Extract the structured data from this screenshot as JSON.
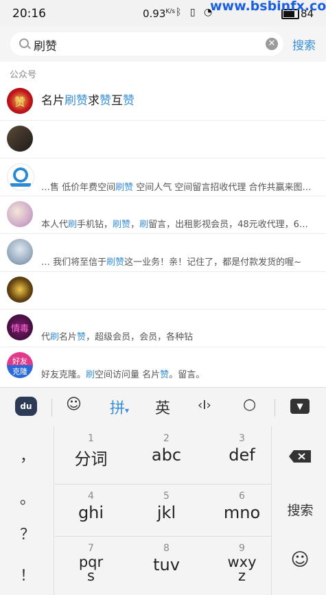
{
  "status": {
    "time": "20:16",
    "speed": "0.93",
    "speed_unit": "K/s",
    "signal": "ᯤ",
    "battery": "84"
  },
  "watermark": "www.bsbinfx.com",
  "search": {
    "query": "刷赞",
    "button": "搜索"
  },
  "section_label": "公众号",
  "results": [
    {
      "segments": [
        {
          "t": "名片",
          "h": false
        },
        {
          "t": "刷赞",
          "h": true
        },
        {
          "t": "求",
          "h": false
        },
        {
          "t": "赞",
          "h": true
        },
        {
          "t": "互",
          "h": false
        },
        {
          "t": "赞",
          "h": true
        }
      ]
    },
    {
      "segments": []
    },
    {
      "segments": [
        {
          "t": "…售 低价年费空间",
          "h": false
        },
        {
          "t": "刷赞",
          "h": true
        },
        {
          "t": " 空间人气 空间留言招收代理 合作共赢来图…",
          "h": false
        }
      ]
    },
    {
      "segments": [
        {
          "t": " 本人代",
          "h": false
        },
        {
          "t": "刷",
          "h": true
        },
        {
          "t": "手机钻，",
          "h": false
        },
        {
          "t": "刷赞",
          "h": true
        },
        {
          "t": "，",
          "h": false
        },
        {
          "t": "刷",
          "h": true
        },
        {
          "t": "留言，出租影视会员，48元收代理，6…",
          "h": false
        }
      ]
    },
    {
      "segments": [
        {
          "t": "… 我们将至信于",
          "h": false
        },
        {
          "t": "刷赞",
          "h": true
        },
        {
          "t": "这一业务！亲！记住了，都是付款发货的喔~",
          "h": false
        }
      ]
    },
    {
      "segments": []
    },
    {
      "segments": [
        {
          "t": "代",
          "h": false
        },
        {
          "t": "刷",
          "h": true
        },
        {
          "t": "名片",
          "h": false
        },
        {
          "t": "赞",
          "h": true
        },
        {
          "t": "，超级会员，会员，各种钻",
          "h": false
        }
      ]
    },
    {
      "segments": [
        {
          "t": "好友克隆。",
          "h": false
        },
        {
          "t": "刷",
          "h": true
        },
        {
          "t": "空间访问量 名片",
          "h": false
        },
        {
          "t": "赞",
          "h": true
        },
        {
          "t": "。留言。",
          "h": false
        }
      ]
    }
  ],
  "keyboard": {
    "toolbar": {
      "pinyin": "拼",
      "english": "英"
    },
    "keys": [
      {
        "num": "1",
        "label": "分词"
      },
      {
        "num": "2",
        "label": "abc"
      },
      {
        "num": "3",
        "label": "def"
      },
      {
        "num": "4",
        "label": "ghi"
      },
      {
        "num": "5",
        "label": "jkl"
      },
      {
        "num": "6",
        "label": "mno"
      },
      {
        "num": "7",
        "label": "pqr\ns"
      },
      {
        "num": "8",
        "label": "tuv"
      },
      {
        "num": "9",
        "label": "wxy\nz"
      }
    ],
    "punct": [
      "，",
      "。",
      "？",
      "！"
    ],
    "search_key": "搜索"
  },
  "colors": {
    "accent": "#3a8fd6"
  }
}
